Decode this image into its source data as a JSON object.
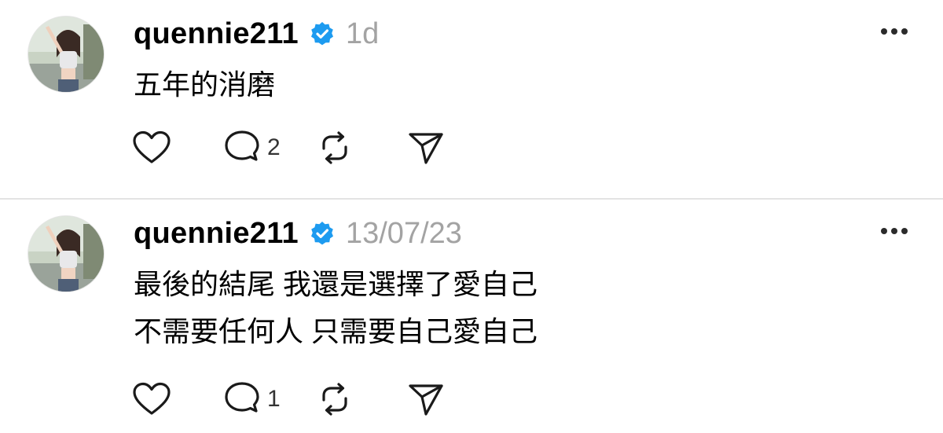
{
  "colors": {
    "verified_badge": "#1d9bf0",
    "timestamp": "#a3a3a3",
    "divider": "#e3e3e3"
  },
  "posts": [
    {
      "username": "quennie211",
      "verified": true,
      "timestamp": "1d",
      "text": "五年的消磨",
      "reply_count": "2",
      "icons": [
        "heart-icon",
        "comment-icon",
        "repost-icon",
        "share-icon",
        "more-icon"
      ]
    },
    {
      "username": "quennie211",
      "verified": true,
      "timestamp": "13/07/23",
      "text": "最後的結尾 我還是選擇了愛自己\n不需要任何人 只需要自己愛自己",
      "reply_count": "1",
      "icons": [
        "heart-icon",
        "comment-icon",
        "repost-icon",
        "share-icon",
        "more-icon"
      ]
    }
  ]
}
